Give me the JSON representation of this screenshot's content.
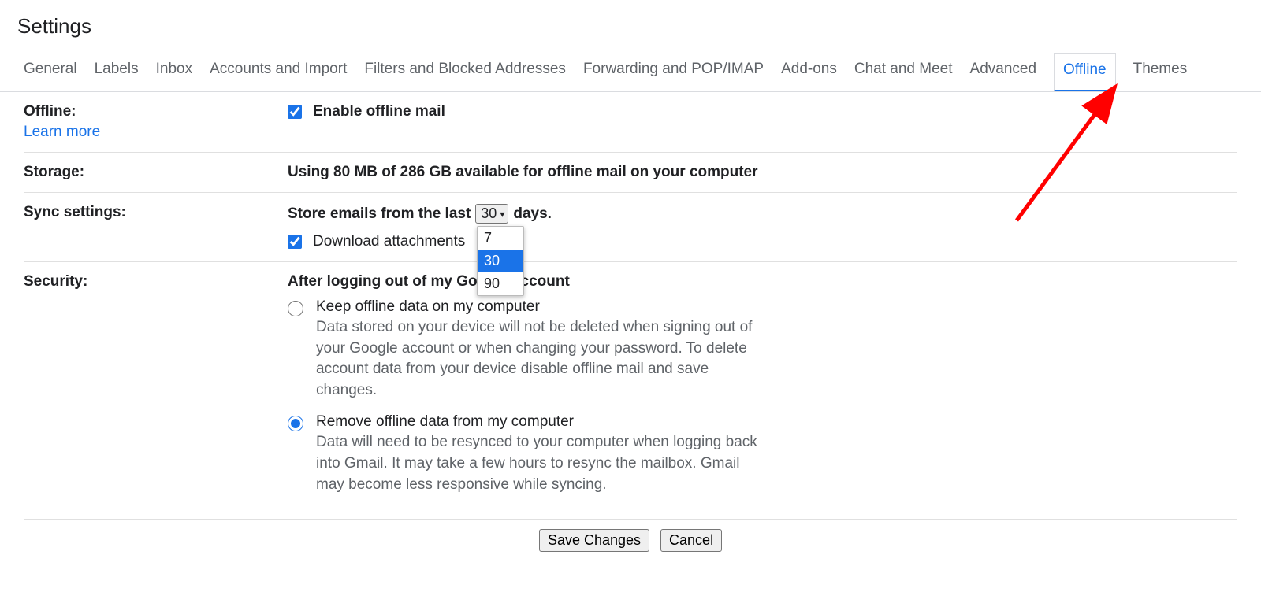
{
  "pageTitle": "Settings",
  "tabs": [
    "General",
    "Labels",
    "Inbox",
    "Accounts and Import",
    "Filters and Blocked Addresses",
    "Forwarding and POP/IMAP",
    "Add-ons",
    "Chat and Meet",
    "Advanced",
    "Offline",
    "Themes"
  ],
  "activeTab": "Offline",
  "offline": {
    "label": "Offline:",
    "learnMore": "Learn more",
    "enableLabel": "Enable offline mail",
    "enabled": true
  },
  "storage": {
    "label": "Storage:",
    "text": "Using 80 MB of 286 GB available for offline mail on your computer"
  },
  "sync": {
    "label": "Sync settings:",
    "storePrefix": "Store emails from the last",
    "storeSuffix": "days.",
    "selected": "30",
    "options": [
      "7",
      "30",
      "90"
    ],
    "downloadLabel": "Download attachments",
    "downloadChecked": true
  },
  "security": {
    "label": "Security:",
    "heading": "After logging out of my Google account...",
    "headingVisiblePre": "After logging out of my Go",
    "headingVisiblePost": "ccount",
    "options": [
      {
        "label": "Keep offline data on my computer",
        "desc": "Data stored on your device will not be deleted when signing out of your Google account or when changing your password. To delete account data from your device disable offline mail and save changes.",
        "selected": false
      },
      {
        "label": "Remove offline data from my computer",
        "desc": "Data will need to be resynced to your computer when logging back into Gmail. It may take a few hours to resync the mailbox. Gmail may become less responsive while syncing.",
        "selected": true
      }
    ]
  },
  "buttons": {
    "save": "Save Changes",
    "cancel": "Cancel"
  }
}
